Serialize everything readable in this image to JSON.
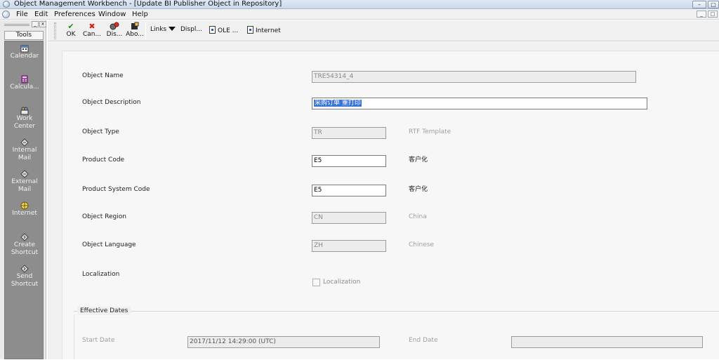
{
  "window": {
    "title": "Object Management Workbench - [Update BI Publisher Object in Repository]",
    "controls": [
      "–",
      "□"
    ]
  },
  "menu": {
    "items": [
      "File",
      "Edit",
      "Preferences",
      "Window",
      "Help"
    ],
    "mdi_controls": [
      "_",
      "□"
    ]
  },
  "tools_pane": {
    "controls": [
      "_",
      "x"
    ],
    "header": "Tools",
    "items": [
      {
        "label": "Calendar",
        "icon": "calendar-icon"
      },
      {
        "label": "Calcula...",
        "icon": "calculator-icon"
      },
      {
        "label": "Work\nCenter",
        "icon": "work-center-icon"
      },
      {
        "label": "Internal\nMail",
        "icon": "internal-mail-icon"
      },
      {
        "label": "External\nMail",
        "icon": "external-mail-icon"
      },
      {
        "label": "Internet",
        "icon": "internet-icon"
      },
      {
        "label": "Create\nShortcut",
        "icon": "create-shortcut-icon"
      },
      {
        "label": "Send\nShortcut",
        "icon": "send-shortcut-icon"
      }
    ]
  },
  "toolbar": {
    "ok": "OK",
    "cancel": "Can...",
    "display": "Dis...",
    "about": "Abo...",
    "links": "Links",
    "display_link": "Displ...",
    "ole": "OLE ...",
    "internet": "Internet"
  },
  "form": {
    "object_name": {
      "label": "Object Name",
      "value": "TRE54314_4"
    },
    "object_description": {
      "label": "Object Description",
      "value": "采购订单 重打印"
    },
    "object_type": {
      "label": "Object Type",
      "value": "TR",
      "description": "RTF Template"
    },
    "product_code": {
      "label": "Product Code",
      "value": "E5",
      "description": "客户化"
    },
    "product_system_code": {
      "label": "Product System Code",
      "value": "E5",
      "description": "客户化"
    },
    "object_region": {
      "label": "Object Region",
      "value": "CN",
      "description": "China"
    },
    "object_language": {
      "label": "Object Language",
      "value": "ZH",
      "description": "Chinese"
    },
    "localization": {
      "label": "Localization",
      "checkbox_label": "Localization",
      "checked": false
    },
    "effective_dates": {
      "title": "Effective Dates",
      "start_label": "Start Date",
      "start_value": "2017/11/12 14:29:00 (UTC)",
      "end_label": "End Date",
      "end_value": ""
    }
  },
  "colors": {
    "selection": "#3874d8",
    "tools_pane": "#8d8d8d",
    "ok_check": "#1e8e1e",
    "cancel_x": "#d42020"
  }
}
